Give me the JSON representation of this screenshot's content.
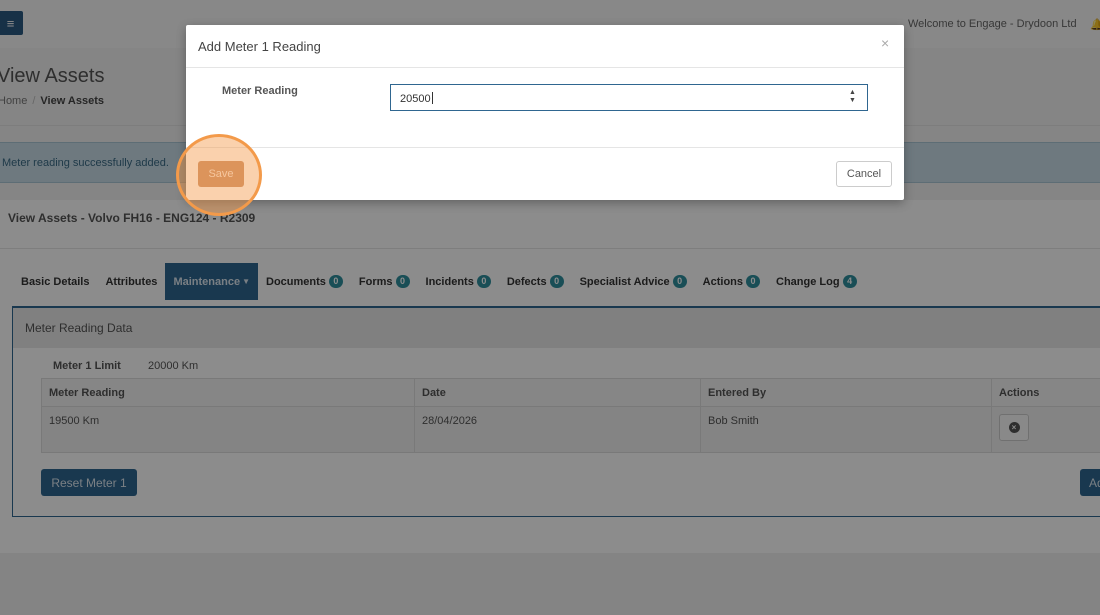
{
  "topbar": {
    "menu_icon": "≡",
    "welcome": "Welcome to Engage - Drydoon Ltd",
    "bell_icon": "🔔"
  },
  "page": {
    "title": "View Assets",
    "breadcrumb": [
      "Home",
      "View Assets"
    ]
  },
  "alert": {
    "text": "Meter reading successfully added."
  },
  "asset": {
    "heading": "View Assets - Volvo FH16 - ENG124 - R2309"
  },
  "tabs": [
    {
      "label": "Basic Details",
      "badge": ""
    },
    {
      "label": "Attributes",
      "badge": ""
    },
    {
      "label": "Maintenance",
      "badge": "",
      "active": true
    },
    {
      "label": "Documents",
      "badge": "0"
    },
    {
      "label": "Forms",
      "badge": "0"
    },
    {
      "label": "Incidents",
      "badge": "0"
    },
    {
      "label": "Defects",
      "badge": "0"
    },
    {
      "label": "Specialist Advice",
      "badge": "0"
    },
    {
      "label": "Actions",
      "badge": "0"
    },
    {
      "label": "Change Log",
      "badge": "4"
    }
  ],
  "meter_data": {
    "heading": "Meter Reading Data",
    "limit_label": "Meter 1 Limit",
    "limit_value": "20000 Km",
    "columns": [
      "Meter Reading",
      "Date",
      "Entered By",
      "Actions"
    ],
    "rows": [
      {
        "reading": "19500 Km",
        "date": "28/04/2026",
        "entered_by": "Bob Smith"
      }
    ],
    "reset_label": "Reset Meter 1",
    "add_label": "Add"
  },
  "modal": {
    "title": "Add Meter 1 Reading",
    "close_icon": "×",
    "field_label": "Meter Reading",
    "field_value": "20500",
    "save_label": "Save",
    "cancel_label": "Cancel"
  },
  "colors": {
    "primary": "#2f6690",
    "badge": "#2f8f9d",
    "save": "#c9916b",
    "highlight_ring": "#f39a4a"
  }
}
